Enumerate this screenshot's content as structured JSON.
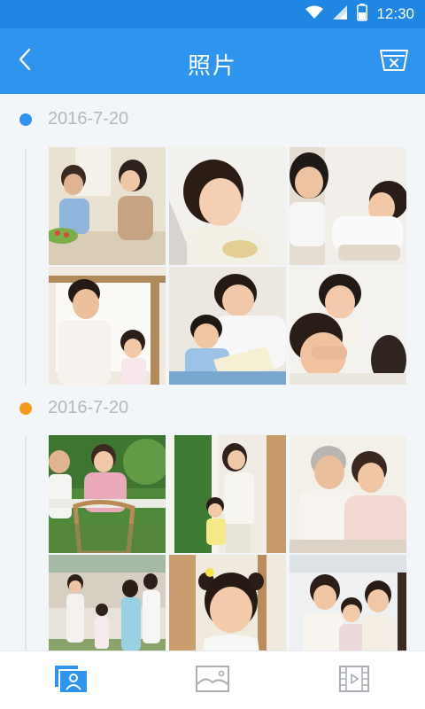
{
  "status_bar": {
    "time": "12:30",
    "icons": [
      "wifi-icon",
      "signal-icon",
      "battery-icon"
    ]
  },
  "header": {
    "title": "照片",
    "back_icon": "chevron-left-icon",
    "action_icon": "trash-bin-icon"
  },
  "groups": [
    {
      "date": "2016-7-20",
      "dot_color": "#2f94ee",
      "photos": [
        "father and daughter with salad in kitchen",
        "girl looking up smiling",
        "brother and sister lying on the floor",
        "father at the window",
        "mother reading a book with her son",
        "girl covering another child's eyes"
      ]
    },
    {
      "date": "2016-7-20",
      "dot_color": "#f59a1d",
      "photos": [
        "father and daughter at a garden table",
        "mother and daughter at a doorway",
        "grandparents smiling",
        "family walking in front of a house",
        "smiling girl with pigtails",
        "mother with two daughters"
      ]
    }
  ],
  "tabs": [
    {
      "icon": "people-photos-icon",
      "active": true
    },
    {
      "icon": "landscape-image-icon",
      "active": false
    },
    {
      "icon": "video-film-icon",
      "active": false
    }
  ],
  "colors": {
    "accent": "#2f94ee",
    "status_bar": "#1f86e3",
    "date_text": "#b3b8bd",
    "second_dot": "#f59a1d"
  }
}
